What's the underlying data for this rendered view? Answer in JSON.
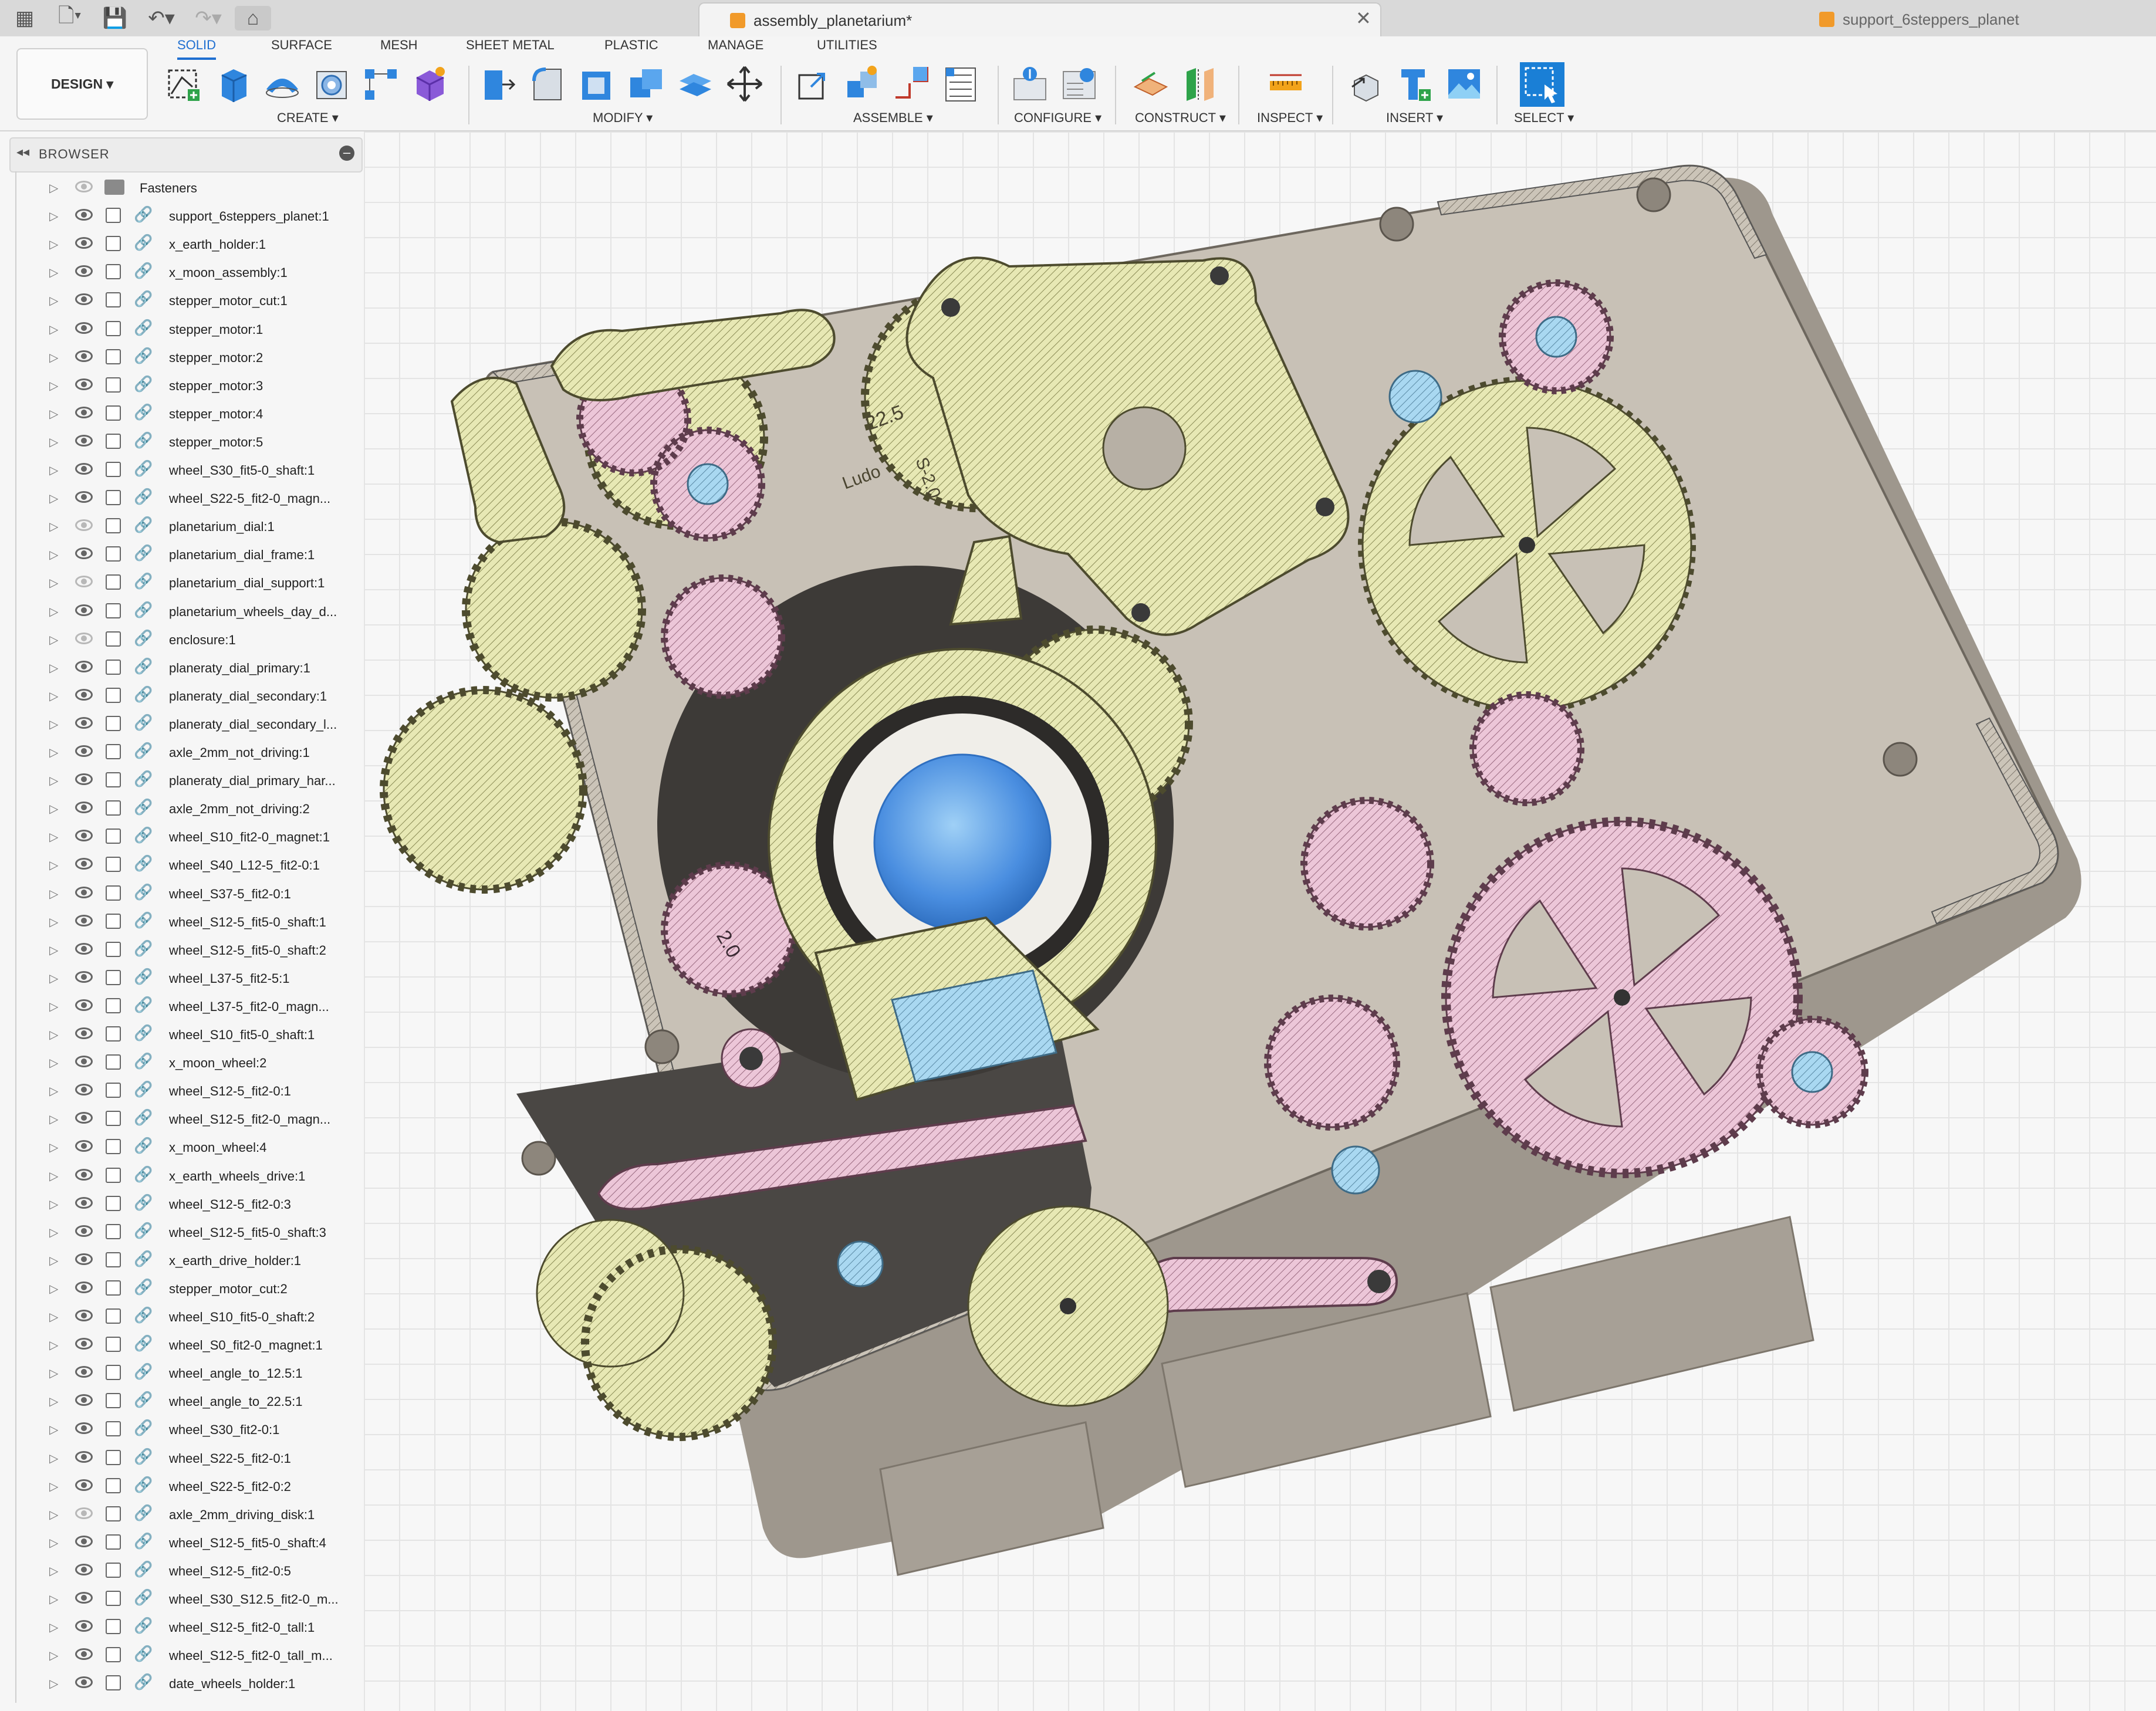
{
  "titlebar": {
    "active_tab": "assembly_planetarium*",
    "inactive_tab": "support_6steppers_planet"
  },
  "toolbar": {
    "design_label": "DESIGN ▾",
    "tabs": [
      "SOLID",
      "SURFACE",
      "MESH",
      "SHEET METAL",
      "PLASTIC",
      "MANAGE",
      "UTILITIES"
    ],
    "active_tab": "SOLID",
    "groups": {
      "create": "CREATE ▾",
      "modify": "MODIFY ▾",
      "assemble": "ASSEMBLE ▾",
      "configure": "CONFIGURE ▾",
      "construct": "CONSTRUCT ▾",
      "inspect": "INSPECT ▾",
      "insert": "INSERT ▾",
      "select": "SELECT ▾"
    }
  },
  "browser": {
    "title": "BROWSER",
    "items": [
      {
        "name": "Fasteners",
        "visible": false,
        "kind": "folder"
      },
      {
        "name": "support_6steppers_planet:1",
        "visible": true,
        "kind": "component"
      },
      {
        "name": "x_earth_holder:1",
        "visible": true,
        "kind": "component"
      },
      {
        "name": "x_moon_assembly:1",
        "visible": true,
        "kind": "component"
      },
      {
        "name": "stepper_motor_cut:1",
        "visible": true,
        "kind": "component"
      },
      {
        "name": "stepper_motor:1",
        "visible": true,
        "kind": "component"
      },
      {
        "name": "stepper_motor:2",
        "visible": true,
        "kind": "component"
      },
      {
        "name": "stepper_motor:3",
        "visible": true,
        "kind": "component"
      },
      {
        "name": "stepper_motor:4",
        "visible": true,
        "kind": "component"
      },
      {
        "name": "stepper_motor:5",
        "visible": true,
        "kind": "component"
      },
      {
        "name": "wheel_S30_fit5-0_shaft:1",
        "visible": true,
        "kind": "component"
      },
      {
        "name": "wheel_S22-5_fit2-0_magn...",
        "visible": true,
        "kind": "component"
      },
      {
        "name": "planetarium_dial:1",
        "visible": false,
        "kind": "component"
      },
      {
        "name": "planetarium_dial_frame:1",
        "visible": true,
        "kind": "component"
      },
      {
        "name": "planetarium_dial_support:1",
        "visible": false,
        "kind": "component"
      },
      {
        "name": "planetarium_wheels_day_d...",
        "visible": true,
        "kind": "component"
      },
      {
        "name": "enclosure:1",
        "visible": false,
        "kind": "component"
      },
      {
        "name": "planeraty_dial_primary:1",
        "visible": true,
        "kind": "component"
      },
      {
        "name": "planeraty_dial_secondary:1",
        "visible": true,
        "kind": "component"
      },
      {
        "name": "planeraty_dial_secondary_l...",
        "visible": true,
        "kind": "component"
      },
      {
        "name": "axle_2mm_not_driving:1",
        "visible": true,
        "kind": "component"
      },
      {
        "name": "planeraty_dial_primary_har...",
        "visible": true,
        "kind": "component"
      },
      {
        "name": "axle_2mm_not_driving:2",
        "visible": true,
        "kind": "component"
      },
      {
        "name": "wheel_S10_fit2-0_magnet:1",
        "visible": true,
        "kind": "component"
      },
      {
        "name": "wheel_S40_L12-5_fit2-0:1",
        "visible": true,
        "kind": "component"
      },
      {
        "name": "wheel_S37-5_fit2-0:1",
        "visible": true,
        "kind": "component"
      },
      {
        "name": "wheel_S12-5_fit5-0_shaft:1",
        "visible": true,
        "kind": "component"
      },
      {
        "name": "wheel_S12-5_fit5-0_shaft:2",
        "visible": true,
        "kind": "component"
      },
      {
        "name": "wheel_L37-5_fit2-5:1",
        "visible": true,
        "kind": "component"
      },
      {
        "name": "wheel_L37-5_fit2-0_magn...",
        "visible": true,
        "kind": "component"
      },
      {
        "name": "wheel_S10_fit5-0_shaft:1",
        "visible": true,
        "kind": "component"
      },
      {
        "name": "x_moon_wheel:2",
        "visible": true,
        "kind": "component"
      },
      {
        "name": "wheel_S12-5_fit2-0:1",
        "visible": true,
        "kind": "component"
      },
      {
        "name": "wheel_S12-5_fit2-0_magn...",
        "visible": true,
        "kind": "component"
      },
      {
        "name": "x_moon_wheel:4",
        "visible": true,
        "kind": "component"
      },
      {
        "name": "x_earth_wheels_drive:1",
        "visible": true,
        "kind": "component"
      },
      {
        "name": "wheel_S12-5_fit2-0:3",
        "visible": true,
        "kind": "component"
      },
      {
        "name": "wheel_S12-5_fit5-0_shaft:3",
        "visible": true,
        "kind": "component"
      },
      {
        "name": "x_earth_drive_holder:1",
        "visible": true,
        "kind": "component"
      },
      {
        "name": "stepper_motor_cut:2",
        "visible": true,
        "kind": "component"
      },
      {
        "name": "wheel_S10_fit5-0_shaft:2",
        "visible": true,
        "kind": "component"
      },
      {
        "name": "wheel_S0_fit2-0_magnet:1",
        "visible": true,
        "kind": "component"
      },
      {
        "name": "wheel_angle_to_12.5:1",
        "visible": true,
        "kind": "component"
      },
      {
        "name": "wheel_angle_to_22.5:1",
        "visible": true,
        "kind": "component"
      },
      {
        "name": "wheel_S30_fit2-0:1",
        "visible": true,
        "kind": "component"
      },
      {
        "name": "wheel_S22-5_fit2-0:1",
        "visible": true,
        "kind": "component"
      },
      {
        "name": "wheel_S22-5_fit2-0:2",
        "visible": true,
        "kind": "component"
      },
      {
        "name": "axle_2mm_driving_disk:1",
        "visible": false,
        "kind": "component"
      },
      {
        "name": "wheel_S12-5_fit5-0_shaft:4",
        "visible": true,
        "kind": "component"
      },
      {
        "name": "wheel_S12-5_fit2-0:5",
        "visible": true,
        "kind": "component"
      },
      {
        "name": "wheel_S30_S12.5_fit2-0_m...",
        "visible": true,
        "kind": "component"
      },
      {
        "name": "wheel_S12-5_fit2-0_tall:1",
        "visible": true,
        "kind": "component"
      },
      {
        "name": "wheel_S12-5_fit2-0_tall_m...",
        "visible": true,
        "kind": "component"
      },
      {
        "name": "date_wheels_holder:1",
        "visible": true,
        "kind": "component"
      }
    ]
  },
  "viewport": {
    "gear_markings": [
      "22.5",
      "S-2.0",
      "Ludo",
      "2.0"
    ]
  },
  "colors": {
    "accent": "#1f6fd1",
    "enclosure": "#bdb7ae",
    "gear_yellow": "#e7e8b4",
    "gear_pink": "#e9bfd3",
    "gear_beige": "#d9d2c4",
    "highlight_blue": "#9fd0ee",
    "sphere": "#4f93e0",
    "dark": "#3a3a3a"
  }
}
